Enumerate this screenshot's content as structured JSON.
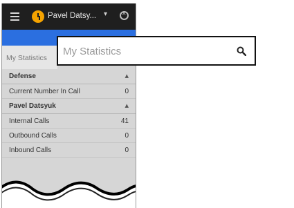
{
  "topbar": {
    "username": "Pavel Datsy...",
    "menu_icon": "hamburger-icon",
    "status_icon": "clock-icon",
    "dropdown_icon": "chevron-down-icon",
    "settings_icon": "settings-icon"
  },
  "tab": {
    "label": "My Statistics"
  },
  "search": {
    "placeholder": "My Statistics",
    "icon": "search-icon"
  },
  "sections": [
    {
      "title": "Defense",
      "rows": [
        {
          "label": "Current Number In Call",
          "value": "0"
        }
      ]
    },
    {
      "title": "Pavel Datsyuk",
      "rows": [
        {
          "label": "Internal Calls",
          "value": "41"
        },
        {
          "label": "Outbound Calls",
          "value": "0"
        },
        {
          "label": "Inbound Calls",
          "value": "0"
        }
      ]
    }
  ],
  "colors": {
    "topbar": "#1f1f1f",
    "accent": "#2b6fe0",
    "status": "#f5a300",
    "panel": "#d6d6d6"
  }
}
